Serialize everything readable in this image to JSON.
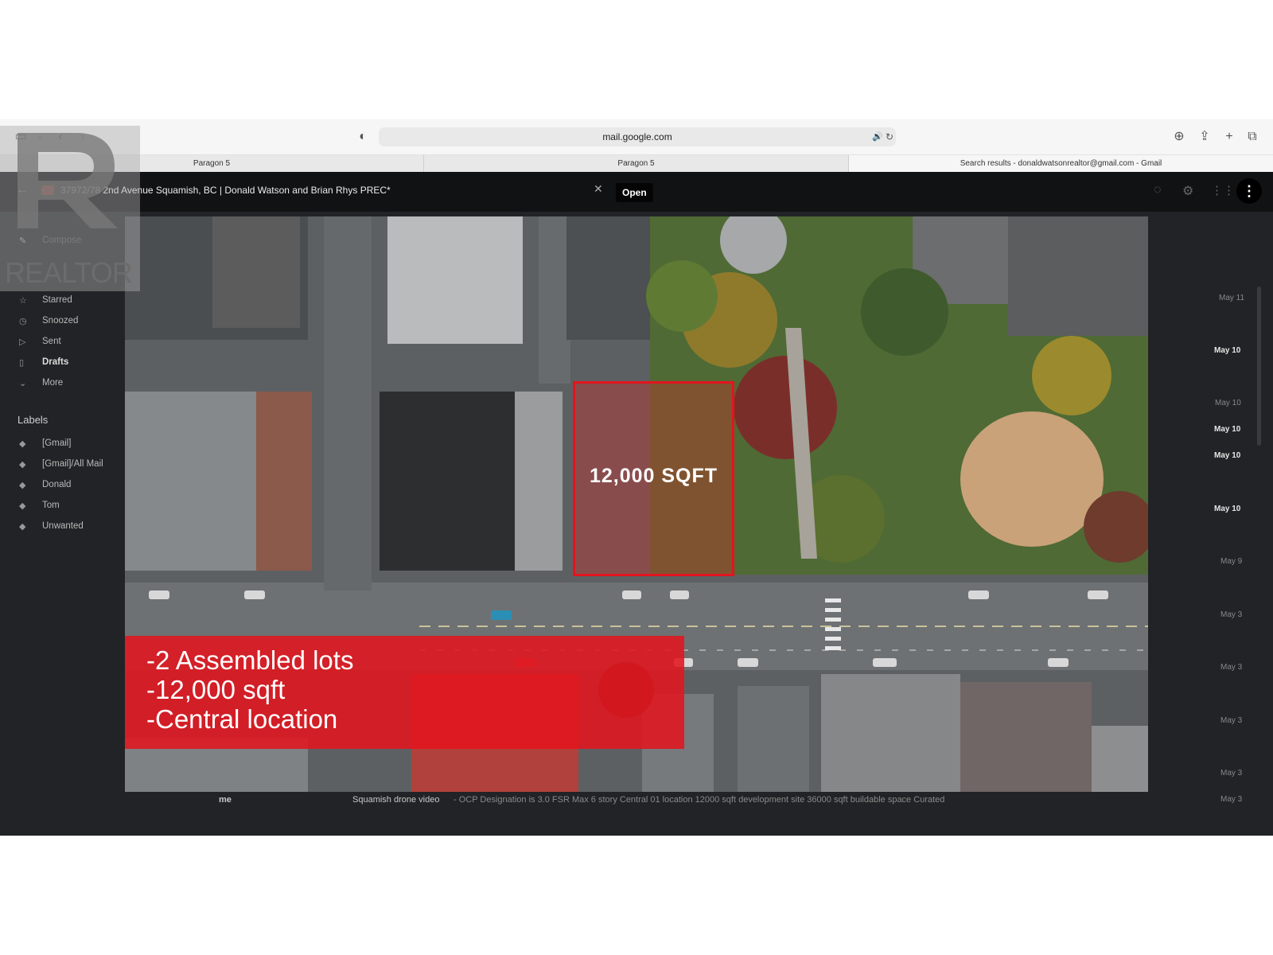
{
  "browser": {
    "url": "mail.google.com",
    "tabs": [
      {
        "label": "Paragon 5"
      },
      {
        "label": "Paragon 5"
      },
      {
        "label": "Search results - donaldwatsonrealtor@gmail.com - Gmail"
      }
    ]
  },
  "video_bar": {
    "title": "37972/78 2nd Avenue Squamish, BC | Donald Watson and Brian Rhys PREC*",
    "open_label": "Open"
  },
  "gmail": {
    "sidebar": {
      "items": [
        {
          "label": "Compose"
        },
        {
          "label": "Starred"
        },
        {
          "label": "Snoozed"
        },
        {
          "label": "Sent"
        },
        {
          "label": "Drafts"
        },
        {
          "label": "More"
        }
      ],
      "labels_heading": "Labels",
      "labels": [
        {
          "label": "[Gmail]"
        },
        {
          "label": "[Gmail]/All Mail"
        },
        {
          "label": "Donald"
        },
        {
          "label": "Tom"
        },
        {
          "label": "Unwanted"
        }
      ]
    },
    "dates": [
      {
        "text": "May 11"
      },
      {
        "text": "May 10"
      },
      {
        "text": "May 10"
      },
      {
        "text": "May 10"
      },
      {
        "text": "May 10"
      },
      {
        "text": "May 10"
      },
      {
        "text": "May 9"
      },
      {
        "text": "May 3"
      },
      {
        "text": "May 3"
      },
      {
        "text": "May 3"
      },
      {
        "text": "May 3"
      },
      {
        "text": "May 3"
      }
    ],
    "bottom_row": {
      "sender": "me",
      "subject": "Squamish drone video",
      "snippet": "- OCP Designation is 3.0 FSR Max 6 story Central 01 location 12000 sqft development site 36000 sqft buildable space Curated"
    }
  },
  "video": {
    "lot_label": "12,000 SQFT",
    "promo_lines": [
      "-2 Assembled lots",
      "-12,000 sqft",
      "-Central location"
    ]
  },
  "watermark": {
    "text": "REALTOR"
  },
  "colors": {
    "accent_red": "#e3141e",
    "overlay_dark": "#222326"
  }
}
